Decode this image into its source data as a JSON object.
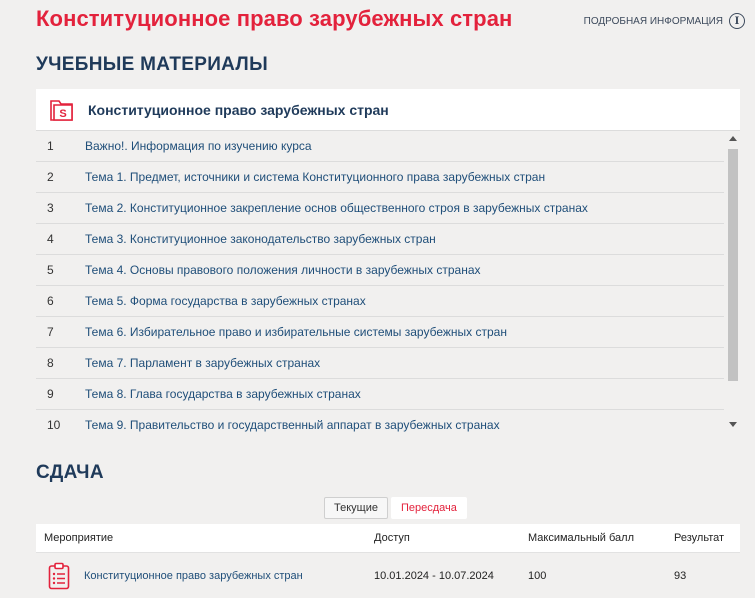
{
  "header": {
    "title": "Конституционное право зарубежных стран",
    "more_info_label": "ПОДРОБНАЯ ИНФОРМАЦИЯ",
    "info_icon": "info-icon"
  },
  "materials": {
    "section_title": "УЧЕБНЫЕ МАТЕРИАЛЫ",
    "course_label": "Конституционное право зарубежных стран",
    "course_icon": "folder-s-icon",
    "topics": [
      {
        "num": "1",
        "title": "Важно!. Информация по изучению курса"
      },
      {
        "num": "2",
        "title": "Тема 1. Предмет, источники и система Конституционного права зарубежных стран"
      },
      {
        "num": "3",
        "title": "Тема 2. Конституционное закрепление основ общественного строя в зарубежных странах"
      },
      {
        "num": "4",
        "title": "Тема 3. Конституционное законодательство зарубежных стран"
      },
      {
        "num": "5",
        "title": "Тема 4. Основы правового положения личности в зарубежных странах"
      },
      {
        "num": "6",
        "title": "Тема 5. Форма государства в зарубежных странах"
      },
      {
        "num": "7",
        "title": "Тема 6. Избирательное право и избирательные системы зарубежных стран"
      },
      {
        "num": "8",
        "title": "Тема 7. Парламент в зарубежных странах"
      },
      {
        "num": "9",
        "title": "Тема 8. Глава государства в зарубежных странах"
      },
      {
        "num": "10",
        "title": "Тема 9. Правительство и государственный аппарат в зарубежных странах"
      }
    ]
  },
  "exams": {
    "section_title": "СДАЧА",
    "tabs": {
      "current": "Текущие",
      "retake": "Пересдача"
    },
    "columns": {
      "event": "Мероприятие",
      "access": "Доступ",
      "max": "Максимальный балл",
      "result": "Результат"
    },
    "rows": [
      {
        "event": "Конституционное право зарубежных стран",
        "access": "10.01.2024 - 10.07.2024",
        "max": "100",
        "result": "93"
      }
    ]
  },
  "colors": {
    "accent": "#e3223c",
    "heading": "#1f3a5a",
    "link": "#1f4e79"
  }
}
